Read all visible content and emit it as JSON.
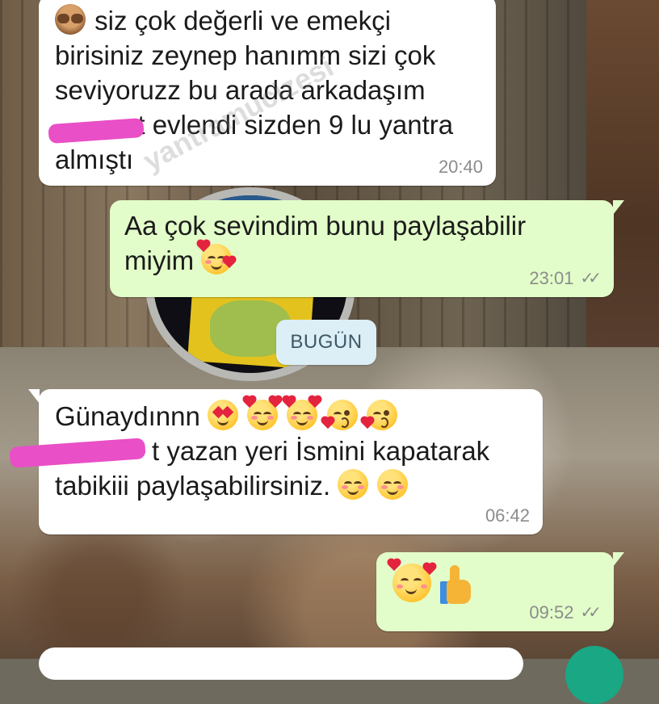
{
  "watermark": "yantramucizesi",
  "date_divider": "BUGÜN",
  "messages": [
    {
      "direction": "incoming",
      "lines": [
        "siz çok değerli ve emekçi",
        "birisiniz zeynep hanımm sizi çok",
        "seviyoruzz bu arada arkadaşım",
        "et evlendi sizden 9 lu yantra",
        "almıştı"
      ],
      "leading_emoji": "see-no-evil-monkey",
      "time": "20:40"
    },
    {
      "direction": "outgoing",
      "lines": [
        "Aa çok sevindim bunu paylaşabilir",
        "miyim"
      ],
      "trailing_emoji": [
        "smiling-face-with-hearts"
      ],
      "time": "23:01",
      "status": "read"
    },
    {
      "direction": "incoming",
      "lines": [
        "Günaydınnn",
        "t yazan yeri İsmini kapatarak",
        "tabikiii paylaşabilirsiniz."
      ],
      "line1_emojis": [
        "heart-eyes",
        "smiling-face-with-hearts",
        "smiling-face-with-hearts",
        "face-blowing-kiss",
        "face-blowing-kiss"
      ],
      "line3_emojis": [
        "smiling-face",
        "smiling-face"
      ],
      "time": "06:42"
    },
    {
      "direction": "outgoing",
      "emojis": [
        "smiling-face-with-hearts",
        "thumbs-up"
      ],
      "time": "09:52",
      "status": "read"
    }
  ],
  "colors": {
    "incoming_bubble": "#ffffff",
    "outgoing_bubble": "#e2fdc9",
    "redaction": "#e94fc6",
    "date_chip": "#dceef6",
    "fab": "#1aa784"
  }
}
